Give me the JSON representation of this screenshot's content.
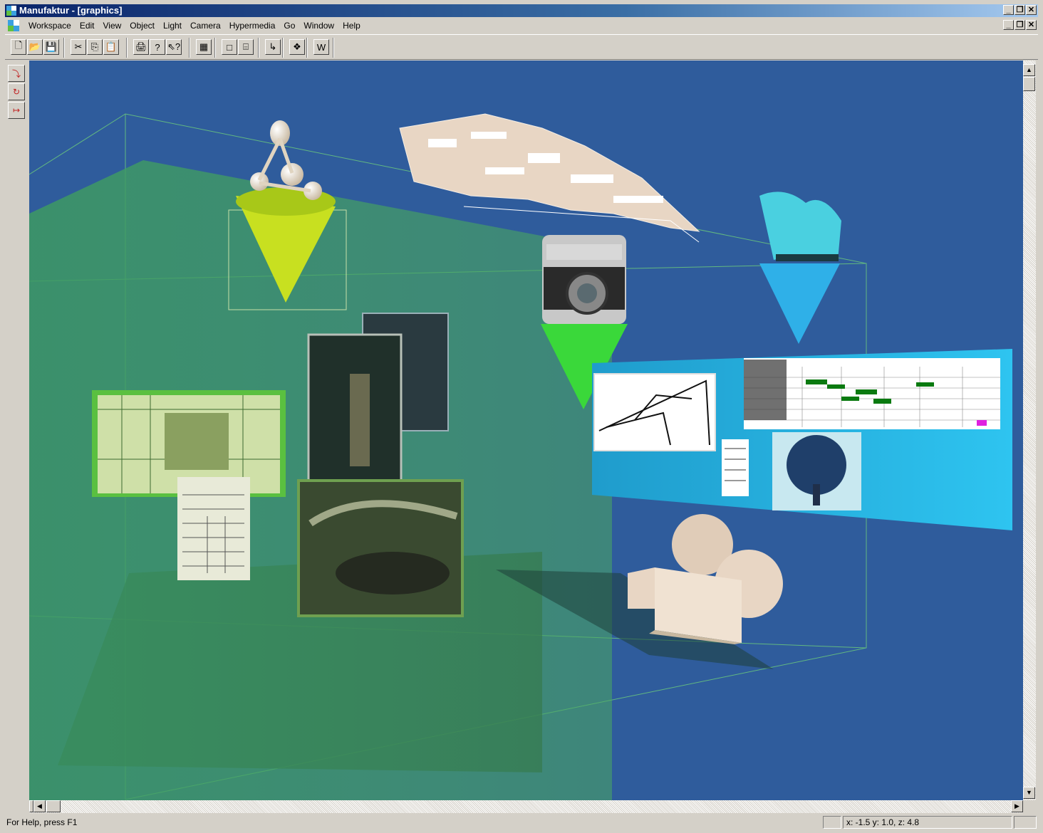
{
  "window": {
    "title": "Manufaktur - [graphics]",
    "controls": {
      "minimize": "_",
      "restore": "❐",
      "close": "✕"
    }
  },
  "menu": {
    "items": [
      "Workspace",
      "Edit",
      "View",
      "Object",
      "Light",
      "Camera",
      "Hypermedia",
      "Go",
      "Window",
      "Help"
    ]
  },
  "toolbar": {
    "buttons": [
      {
        "name": "new-file-icon",
        "glyph": "🗋"
      },
      {
        "name": "open-folder-icon",
        "glyph": "📂"
      },
      {
        "name": "save-icon",
        "glyph": "💾"
      },
      {
        "name": "cut-icon",
        "glyph": "✂"
      },
      {
        "name": "copy-icon",
        "glyph": "⎘"
      },
      {
        "name": "paste-icon",
        "glyph": "📋"
      },
      {
        "name": "print-icon",
        "glyph": "🖨"
      },
      {
        "name": "help-icon",
        "glyph": "?"
      },
      {
        "name": "context-help-icon",
        "glyph": "⇖?"
      },
      {
        "name": "grid-icon",
        "glyph": "▦"
      },
      {
        "name": "cube-icon",
        "glyph": "□"
      },
      {
        "name": "cylinder-icon",
        "glyph": "⌸"
      },
      {
        "name": "import-icon",
        "glyph": "↳"
      },
      {
        "name": "object-icon",
        "glyph": "❖"
      },
      {
        "name": "web-icon",
        "glyph": "W"
      }
    ]
  },
  "left_toolbar": {
    "buttons": [
      {
        "name": "rotate-icon",
        "glyph": "⤵"
      },
      {
        "name": "navigate-icon",
        "glyph": "↻"
      },
      {
        "name": "move-icon",
        "glyph": "↦"
      }
    ]
  },
  "scrollbars": {
    "up": "▲",
    "down": "▼",
    "left": "◀",
    "right": "▶"
  },
  "status": {
    "help_text": "For Help, press F1",
    "coordinates": "x: -1.5 y: 1.0, z: 4.8"
  },
  "colors": {
    "viewport_bg": "#2f5c9c",
    "green_room": "#4aa860",
    "yellow_cone": "#c8e020",
    "green_cone": "#3ad83a",
    "blue_cone": "#2fb0e8",
    "panel_cyan": "#2ab6e6",
    "model_beige": "#e8d6c4"
  }
}
